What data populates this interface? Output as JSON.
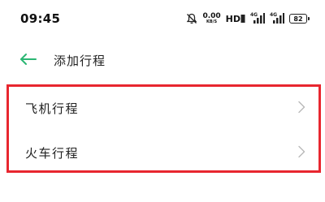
{
  "status_bar": {
    "time": "09:45",
    "net_speed_value": "0.00",
    "net_speed_unit": "KB/S",
    "hd_label": "HD",
    "signal1_label": "4G",
    "signal2_label": "4G",
    "battery_level": "82",
    "icons": [
      "mute-bell-icon",
      "hd-voice-icon",
      "signal-icon",
      "signal-icon",
      "battery-icon"
    ]
  },
  "header": {
    "back_icon": "back-arrow-icon",
    "title": "添加行程",
    "accent_color": "#2bb673"
  },
  "trip_types": [
    {
      "label": "飞机行程",
      "icon": "chevron-right-icon"
    },
    {
      "label": "火车行程",
      "icon": "chevron-right-icon"
    }
  ],
  "highlight_color": "#e8262f"
}
